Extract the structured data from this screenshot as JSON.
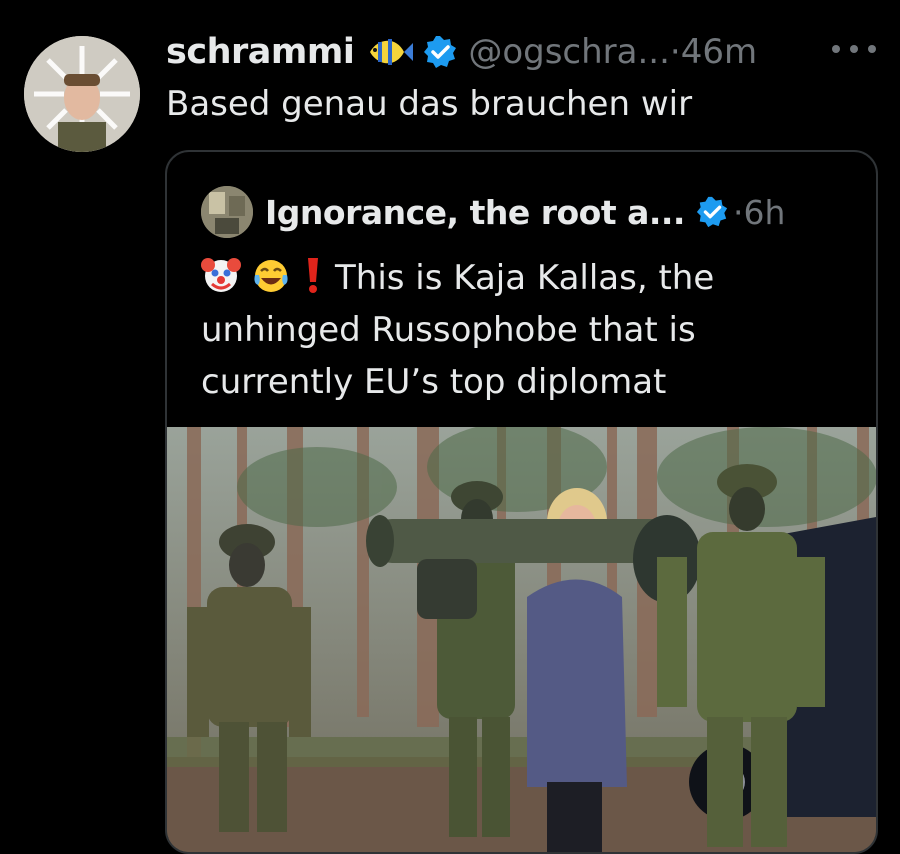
{
  "tweet": {
    "author_name": "schrammi",
    "handle": "@ogschra...",
    "time": "·46m",
    "text": "Based genau das brauchen wir"
  },
  "quoted": {
    "author_name": "Ignorance, the root a...",
    "time": "·6h",
    "lines": [
      "This is Kaja Kallas, the",
      "unhinged Russophobe that is",
      "currently EU’s top diplomat"
    ]
  },
  "icons": {
    "author_badge": "tropical-fish-icon",
    "verified": "verified-badge-icon",
    "more": "more-options-icon",
    "emoji_1": "clown-face-emoji",
    "emoji_2": "tears-of-joy-emoji",
    "emoji_3": "exclamation-mark-emoji"
  },
  "colors": {
    "background": "#000000",
    "text": "#e7e9ea",
    "secondary": "#71767b",
    "verified": "#1d9bf0",
    "border": "#2f3336"
  }
}
